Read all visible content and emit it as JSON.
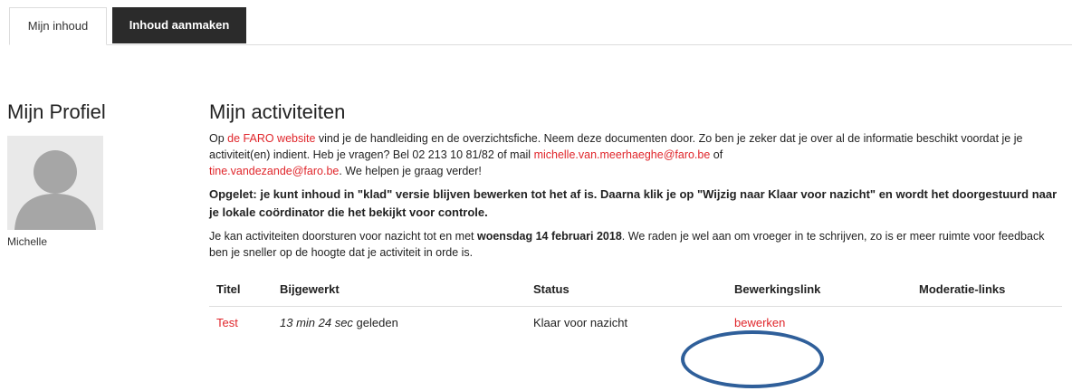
{
  "tabs": {
    "mine": "Mijn inhoud",
    "create": "Inhoud aanmaken"
  },
  "profile": {
    "title": "Mijn Profiel",
    "name": "Michelle"
  },
  "activities": {
    "title": "Mijn activiteiten",
    "p1": {
      "a": "Op ",
      "link": "de FARO website",
      "b": " vind je de handleiding en de overzichtsfiche. Neem deze documenten door. Zo ben je zeker dat je over al de informatie beschikt voordat je je activiteit(en) indient. Heb je vragen? Bel 02 213 10 81/82 of mail ",
      "email1": "michelle.van.meerhaeghe@faro.be",
      "c": " of ",
      "email2": "tine.vandezande@faro.be",
      "d": ". We helpen je graag verder!"
    },
    "p2": "Opgelet: je kunt inhoud in \"klad\" versie blijven bewerken tot het af is. Daarna klik je op \"Wijzig naar Klaar voor nazicht\" en wordt het doorgestuurd naar je lokale coördinator die het bekijkt voor controle.",
    "p3": {
      "a": "Je kan activiteiten doorsturen voor nazicht tot en met ",
      "date": "woensdag 14 februari 2018",
      "b": ". We raden je wel aan om vroeger in te schrijven, zo is er meer ruimte voor feedback ben je sneller op de hoogte dat je activiteit in orde is."
    }
  },
  "table": {
    "headers": [
      "Titel",
      "Bijgewerkt",
      "Status",
      "Bewerkingslink",
      "Moderatie-links"
    ],
    "row": {
      "title": "Test",
      "updated_time": "13 min 24 sec",
      "updated_suffix": " geleden",
      "status": "Klaar voor nazicht",
      "edit": "bewerken",
      "moderation": ""
    }
  },
  "colors": {
    "link": "#e0262b",
    "dark_tab": "#2b2b2b",
    "highlight_circle": "#2f5f9a"
  }
}
